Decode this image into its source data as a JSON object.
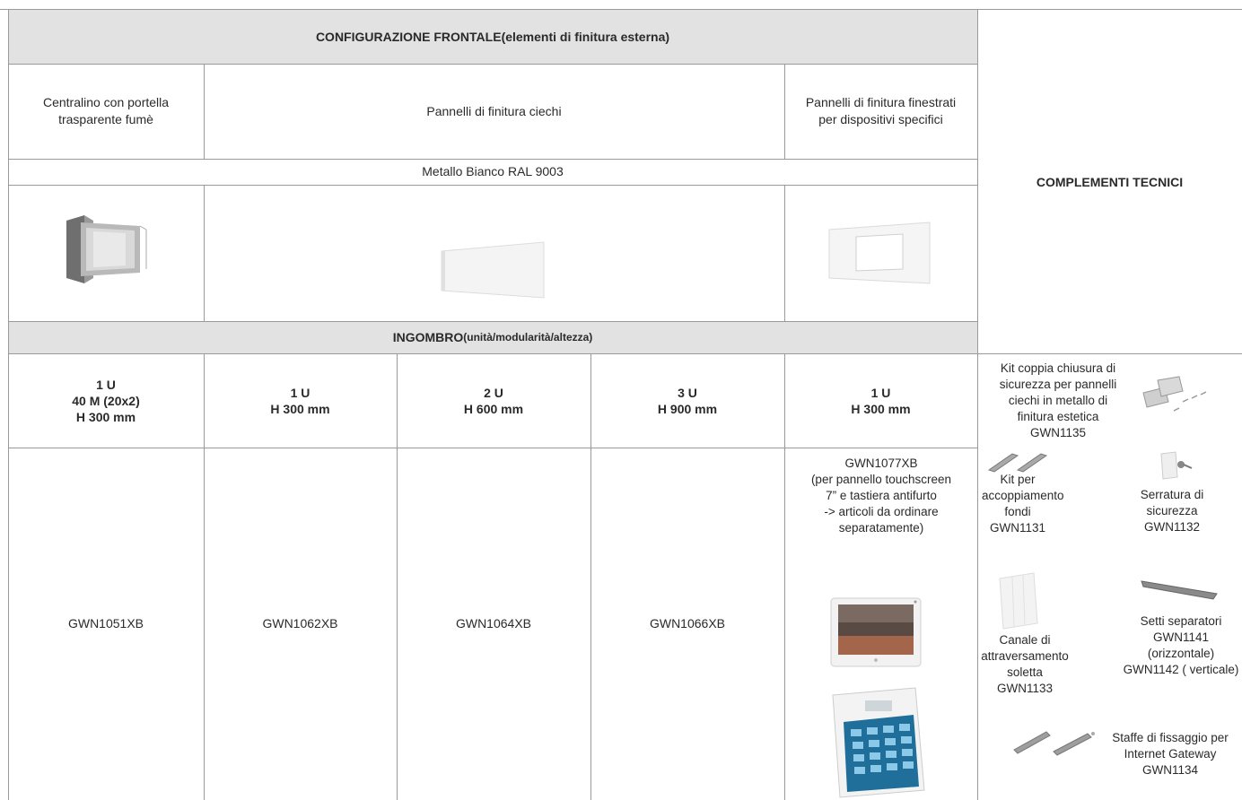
{
  "header": {
    "title_bold": "CONFIGURAZIONE FRONTALE",
    "title_rest": " (elementi di finitura esterna)",
    "complementi": "COMPLEMENTI TECNICI"
  },
  "categories": {
    "centralino": [
      "Centralino con portella",
      "trasparente fumè"
    ],
    "pannelli_ciechi": "Pannelli di finitura ciechi",
    "pannelli_finestrati": [
      "Pannelli di finitura finestrati",
      "per dispositivi specifici"
    ]
  },
  "material": "Metallo Bianco RAL 9003",
  "ingombro": {
    "bold": "INGOMBRO",
    "rest": " (unità/modularità/altezza)"
  },
  "sizes": [
    [
      "1 U",
      "40 M (20x2)",
      "H 300 mm"
    ],
    [
      "1 U",
      "H 300 mm"
    ],
    [
      "2 U",
      "H 600 mm"
    ],
    [
      "3 U",
      "H 900 mm"
    ],
    [
      "1 U",
      "H 300 mm"
    ]
  ],
  "codes": [
    "GWN1051XB",
    "GWN1062XB",
    "GWN1064XB",
    "GWN1066XB"
  ],
  "special": [
    "GWN1077XB",
    "(per pannello touchscreen",
    "7” e tastiera antifurto",
    "-> articoli da ordinare",
    "separatamente)"
  ],
  "complementi_items": [
    [
      "Kit coppia chiusura di",
      "sicurezza per pannelli",
      "ciechi in metallo di",
      "finitura estetica",
      "GWN1135"
    ],
    [
      "Kit per",
      "accoppiamento",
      "fondi",
      "GWN1131"
    ],
    [
      "Serratura di",
      "sicurezza",
      "GWN1132"
    ],
    [
      "Canale di",
      "attraversamento",
      "soletta",
      "GWN1133"
    ],
    [
      "Setti separatori",
      "GWN1141",
      "(orizzontale)",
      "GWN1142 ( verticale)"
    ],
    [
      "Staffe di fissaggio per",
      "Internet Gateway",
      "GWN1134"
    ]
  ],
  "colors": {
    "header_grey": "#e2e2e2",
    "border": "#9a9a9a"
  },
  "icons": [
    "smoked-door-panel-icon",
    "blind-panel-icon",
    "windowed-panel-icon",
    "touchscreen-icon",
    "alarm-keypad-icon",
    "lock-kit-icon",
    "coupling-kit-icon",
    "key-lock-icon",
    "crossing-channel-icon",
    "separator-icon",
    "brackets-icon"
  ]
}
